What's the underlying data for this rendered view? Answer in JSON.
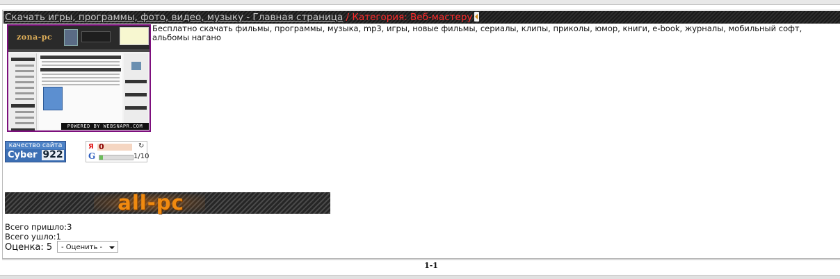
{
  "breadcrumb": {
    "home_link": "Скачать игры, программы, фото, видео, музыку - Главная страница",
    "separator": " / ",
    "current": "Категория: Веб-мастеру"
  },
  "thumbnail": {
    "logo_text": "zona-pc",
    "powered_by": "POWERED BY WEBSNAPR.COM"
  },
  "description": "Бесплатно скачать фильмы, программы, музыка, mp3, игры, новые фильмы, сериалы, клипы, приколы, юмор, книги, e-book, журналы, мобильный софт, альбомы нагано",
  "badges": {
    "cyber": {
      "top_text": "качество сайта",
      "name": "Cyber",
      "value": "922"
    },
    "rank": {
      "yandex_icon": "Я",
      "yandex_value": "0",
      "refresh_icon": "↻",
      "google_icon": "G",
      "pagerank_text": "1/10",
      "pagerank_fraction": 0.1
    }
  },
  "banner": {
    "logo_text": "all-pc"
  },
  "stats": {
    "came_in": "Всего пришло:3",
    "went_out": "Всего ушло:1"
  },
  "rating": {
    "label": "Оценка: 5",
    "select_value": "- Оценить -"
  },
  "pagination": "1-1",
  "colors": {
    "header_bg": "#222222",
    "link_gray": "#c9c9c9",
    "category_red": "#ff2b2b",
    "thumb_border": "#7d0f7d",
    "banner_orange": "#f08a10"
  }
}
